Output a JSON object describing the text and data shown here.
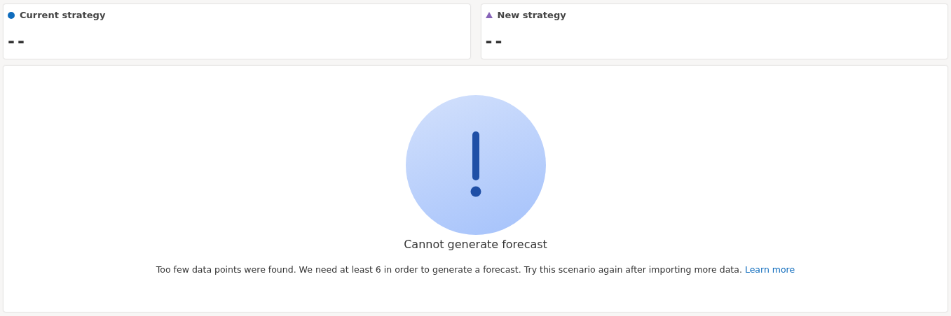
{
  "strategies": [
    {
      "label": "Current strategy",
      "kind": "circle",
      "color": "#0f6cbd",
      "value": "--"
    },
    {
      "label": "New strategy",
      "kind": "triangle",
      "color": "#8764b8",
      "value": "--"
    }
  ],
  "message": {
    "title": "Cannot generate forecast",
    "text": "Too few data points were found. We need at least 6 in order to generate a forecast. Try this scenario again after importing more data.",
    "link": "Learn more"
  }
}
